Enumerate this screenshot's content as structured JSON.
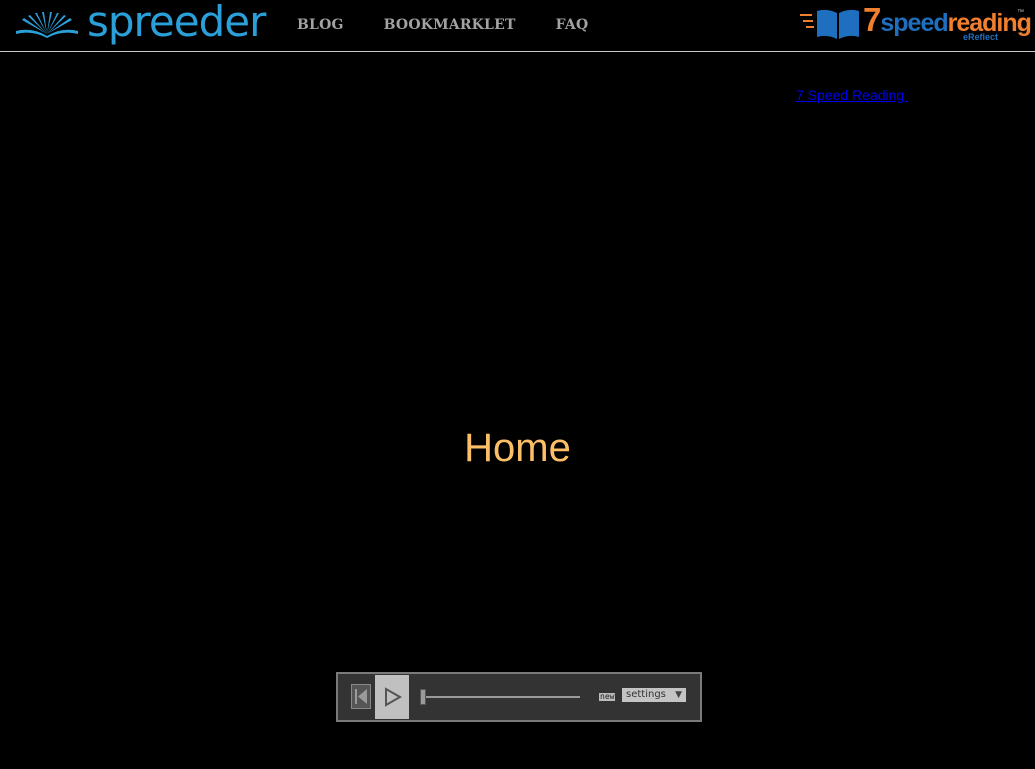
{
  "header": {
    "logo_text": "spreeder",
    "nav": [
      {
        "label": "BLOG"
      },
      {
        "label": "BOOKMARKLET"
      },
      {
        "label": "FAQ"
      }
    ],
    "brand": {
      "seven": "7",
      "speed": "speed",
      "reading": "reading",
      "tm": "™",
      "sub": "eReflect"
    }
  },
  "main": {
    "link_text": "7 Speed Reading ",
    "current_word": "Home"
  },
  "player": {
    "new_badge": "new",
    "settings_label": "settings",
    "settings_arrow": "▼",
    "progress": 0
  },
  "colors": {
    "logo_blue": "#2a9fd8",
    "word": "#fdbf66",
    "brand_orange": "#f08030",
    "brand_blue": "#1f6fc0",
    "link": "#0000ee"
  }
}
